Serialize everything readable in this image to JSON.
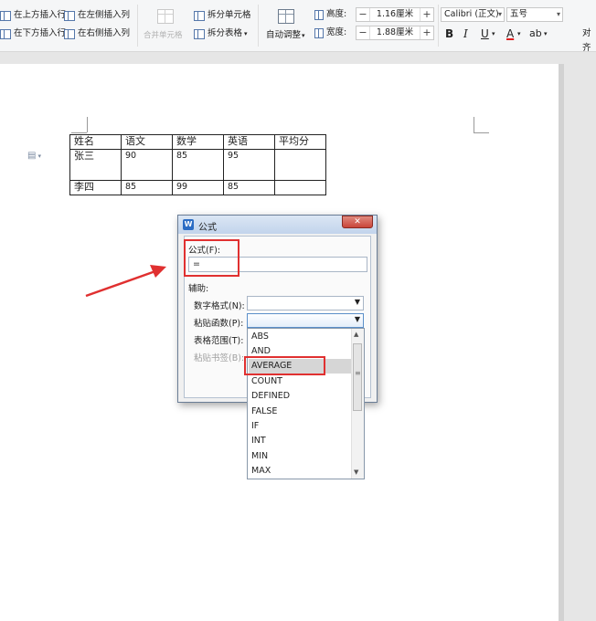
{
  "ribbon": {
    "insert_above": "在上方插入行",
    "insert_below": "在下方插入行",
    "insert_left": "在左侧插入列",
    "insert_right": "在右侧插入列",
    "merge_cells": "合并单元格",
    "split_cells": "拆分单元格",
    "split_table": "拆分表格",
    "auto_fit": "自动调整",
    "height_label": "高度:",
    "height_value": "1.16厘米",
    "width_label": "宽度:",
    "width_value": "1.88厘米",
    "font_name": "Calibri (正文)",
    "font_size": "五号",
    "bold": "B",
    "italic": "I",
    "underline": "U",
    "font_color": "A",
    "highlight": "ab",
    "align": "对齐",
    "minus": "−",
    "plus": "+"
  },
  "table": {
    "headers": [
      "姓名",
      "语文",
      "数学",
      "英语",
      "平均分"
    ],
    "rows": [
      [
        "张三",
        "90",
        "85",
        "95",
        ""
      ],
      [
        "李四",
        "85",
        "99",
        "85",
        ""
      ]
    ]
  },
  "dialog": {
    "title": "公式",
    "formula_label": "公式(F):",
    "formula_value": "=",
    "assist_label": "辅助:",
    "number_format_label": "数字格式(N):",
    "paste_function_label": "粘贴函数(P):",
    "table_range_label": "表格范围(T):",
    "paste_bookmark_label": "粘贴书签(B):",
    "close": "✕"
  },
  "functions": [
    "ABS",
    "AND",
    "AVERAGE",
    "COUNT",
    "DEFINED",
    "FALSE",
    "IF",
    "INT",
    "MIN",
    "MAX"
  ],
  "selected_function": "AVERAGE",
  "colors": {
    "annotation_red": "#e03030",
    "close_button": "#c9453a",
    "font_color_underline": "#e02020",
    "title_icon": "#2b6cc4"
  }
}
